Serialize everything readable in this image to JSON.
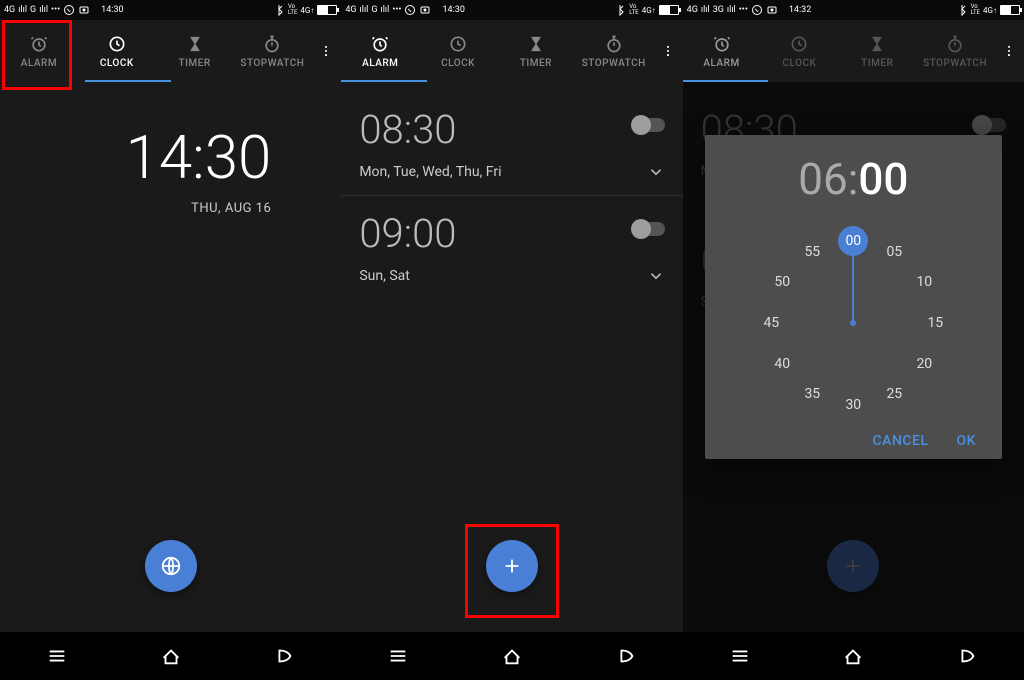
{
  "statusbar": {
    "net_left": "4G",
    "g_left": "G",
    "time1": "14:30",
    "time2": "14:30",
    "time3": "14:32",
    "vlte": "Vo\nLTE",
    "lte4g": "4G"
  },
  "tabs": {
    "alarm": "ALARM",
    "clock": "CLOCK",
    "timer": "TIMER",
    "stopwatch": "STOPWATCH"
  },
  "clockPage": {
    "time": "14:30",
    "date": "THU, AUG 16"
  },
  "alarms": [
    {
      "time": "08:30",
      "days": "Mon, Tue, Wed, Thu, Fri"
    },
    {
      "time": "09:00",
      "days": "Sun, Sat"
    }
  ],
  "picker": {
    "hours": "06",
    "minutes": "00",
    "ticks": [
      "00",
      "05",
      "10",
      "15",
      "20",
      "25",
      "30",
      "35",
      "40",
      "45",
      "50",
      "55"
    ],
    "cancel": "CANCEL",
    "ok": "OK"
  },
  "sig_text": "ılıl"
}
